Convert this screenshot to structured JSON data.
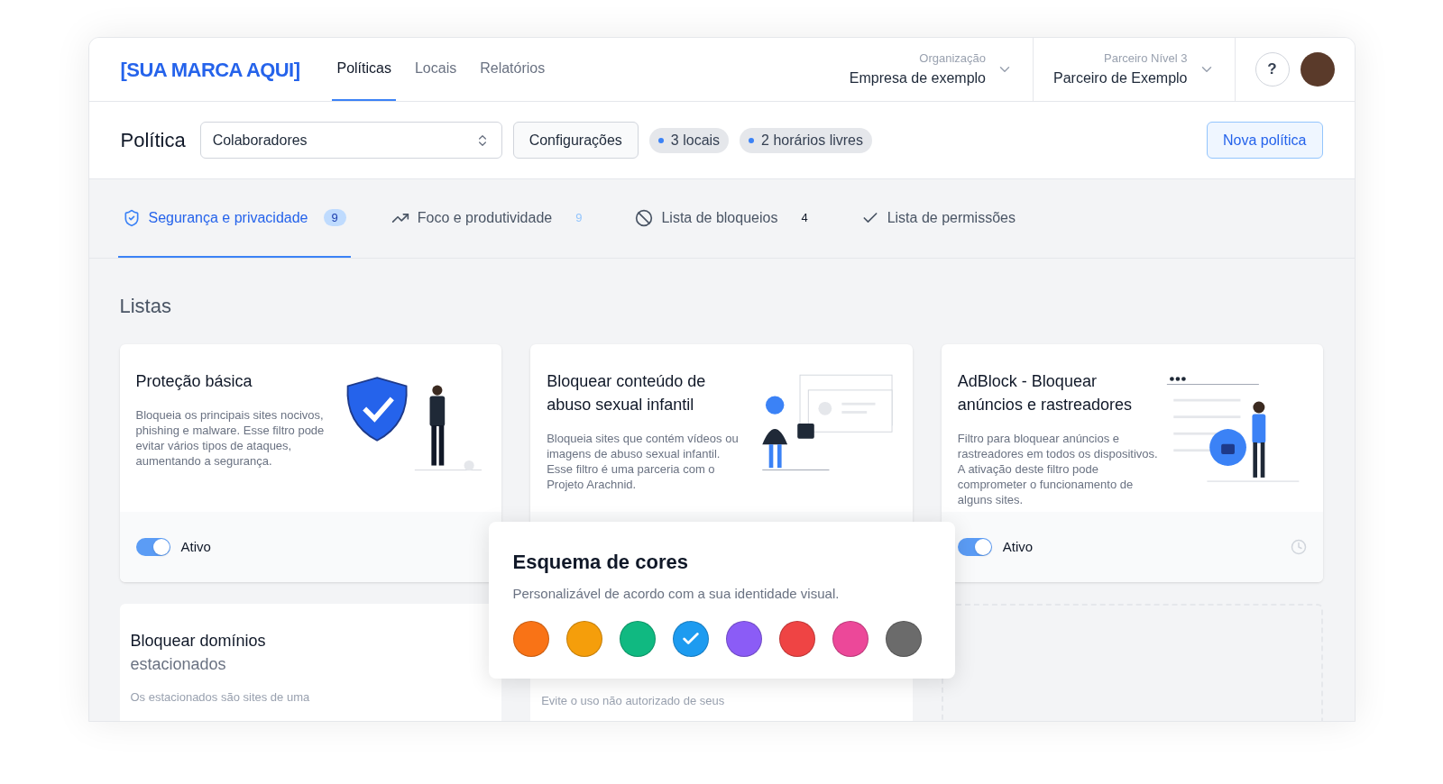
{
  "header": {
    "brand": "[SUA MARCA AQUI]",
    "nav": [
      {
        "label": "Políticas",
        "selected": true
      },
      {
        "label": "Locais",
        "selected": false
      },
      {
        "label": "Relatórios",
        "selected": false
      }
    ],
    "selectors": [
      {
        "caption": "Organização",
        "value": "Empresa de exemplo"
      },
      {
        "caption": "Parceiro Nível 3",
        "value": "Parceiro de Exemplo"
      }
    ],
    "help": "?"
  },
  "policy_bar": {
    "title": "Política",
    "select_value": "Colaboradores",
    "settings_button": "Configurações",
    "chips": [
      "3 locais",
      "2 horários livres"
    ],
    "new_button": "Nova política"
  },
  "tabs": [
    {
      "kind": "shield",
      "label": "Segurança e privacidade",
      "count": "9",
      "selected": true
    },
    {
      "kind": "trend",
      "label": "Foco e produtividade",
      "count": "9",
      "selected": false
    },
    {
      "kind": "block",
      "label": "Lista de bloqueios",
      "count": "4",
      "selected": false
    },
    {
      "kind": "check",
      "label": "Lista de permissões",
      "selected": false
    }
  ],
  "section_title": "Listas",
  "cards": [
    {
      "kind": "shield",
      "title": "Proteção básica",
      "description": "Bloqueia os principais sites nocivos, phishing e malware. Esse filtro pode evitar vários tipos de ataques, aumentando a segurança.",
      "on": true,
      "status": "Ativo"
    },
    {
      "kind": "lock",
      "title": "Bloquear conteúdo de abuso sexual infantil",
      "description": "Bloqueia sites que contém vídeos ou imagens de abuso sexual infantil. Esse filtro é uma parceria com o Projeto Arachnid."
    },
    {
      "kind": "browser",
      "title": "AdBlock - Bloquear anúncios e rastreadores",
      "description": "Filtro para bloquear anúncios e rastreadores em todos os dispositivos. A ativação deste filtro pode comprometer o funcionamento de alguns sites.",
      "on": true,
      "status": "Ativo",
      "clock": true
    }
  ],
  "faded_cards": [
    {
      "title": "Bloquear domínios",
      "subtitle": "estacionados",
      "description": "Os estacionados são sites de uma"
    },
    {
      "description": "Evite o uso não autorizado de seus"
    }
  ],
  "color_popup": {
    "title": "Esquema de cores",
    "subtitle": "Personalizável de acordo com a sua identidade visual.",
    "swatches": [
      {
        "color": "#f97316",
        "selected": false
      },
      {
        "color": "#f59e0b",
        "selected": false
      },
      {
        "color": "#10b981",
        "selected": false
      },
      {
        "color": "#1d9bf0",
        "selected": true
      },
      {
        "color": "#8b5cf6",
        "selected": false
      },
      {
        "color": "#ef4444",
        "selected": false
      },
      {
        "color": "#ec4899",
        "selected": false
      },
      {
        "color": "#6b6b6b",
        "selected": false
      }
    ]
  }
}
